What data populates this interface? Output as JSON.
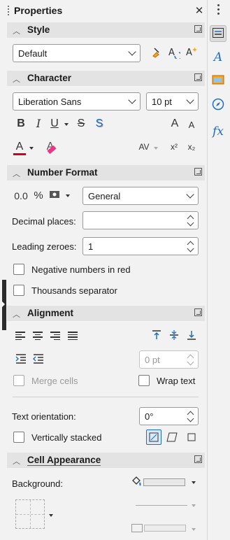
{
  "panel": {
    "title": "Properties"
  },
  "sections": {
    "style": "Style",
    "character": "Character",
    "number_format": "Number Format",
    "alignment": "Alignment",
    "cell_appearance": "Cell Appearance"
  },
  "style": {
    "value": "Default"
  },
  "character": {
    "font": "Liberation Sans",
    "size": "10 pt"
  },
  "number_format": {
    "format": "General",
    "decimal_places_label": "Decimal places:",
    "decimal_places_value": "",
    "leading_zeroes_label": "Leading zeroes:",
    "leading_zeroes_value": "1",
    "negative_red_label": "Negative numbers in red",
    "thousands_label": "Thousands separator",
    "percent_symbol": "%"
  },
  "alignment": {
    "indent_value": "0 pt",
    "merge_cells_label": "Merge cells",
    "wrap_text_label": "Wrap text",
    "text_orientation_label": "Text orientation:",
    "text_orientation_value": "0°",
    "vertically_stacked_label": "Vertically stacked"
  },
  "cell_appearance": {
    "background_label": "Background:"
  },
  "char_labels": {
    "bold": "B",
    "italic": "I",
    "underline": "U",
    "strike": "S",
    "shadow": "S",
    "font_color": "A",
    "highlight": "A",
    "spacing": "AV",
    "superscript": "x²",
    "subscript": "x₂",
    "grow": "A",
    "shrink": "A",
    "fx": "fx"
  },
  "icons": {
    "accent": "#1e6fc2",
    "font_color_bar": "#d0021b",
    "highlight_bar": "#d0021b"
  }
}
